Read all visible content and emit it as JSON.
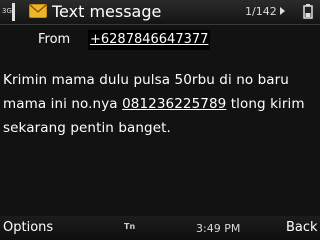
{
  "status_bar": {
    "network_label": "3G",
    "app_icon": "envelope-icon",
    "title": "Text message",
    "message_position": "1/142",
    "nav_icon": "right-arrow-icon",
    "battery_icon": "battery-icon"
  },
  "header": {
    "from_label": "From",
    "from_value": "+6287846647377"
  },
  "message": {
    "text_before_link": "Krimin mama dulu pulsa 50rbu di no baru mama ini no.nya ",
    "phone_link": "081236225789",
    "text_after_link": " tlong kirim sekarang pentin banget."
  },
  "bottom_bar": {
    "left_softkey": "Options",
    "input_mode": "Tn",
    "clock": "3:49 PM",
    "right_softkey": "Back"
  },
  "colors": {
    "background": "#121212",
    "text": "#ffffff",
    "envelope": "#f0b429"
  }
}
